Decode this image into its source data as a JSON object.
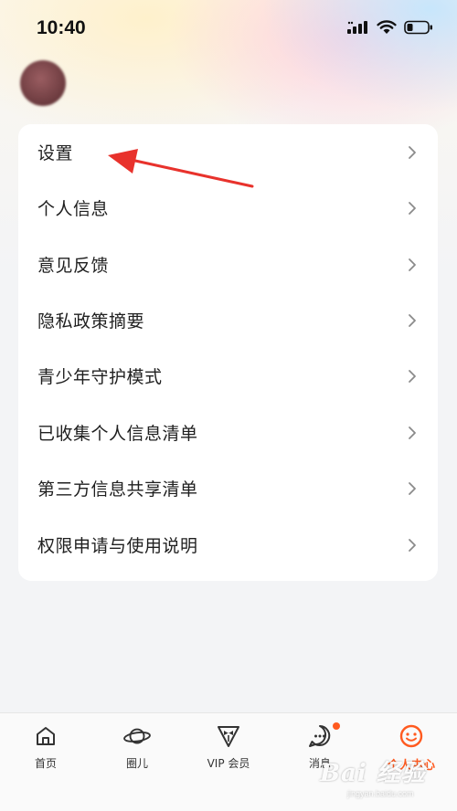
{
  "status_bar": {
    "time": "10:40",
    "icons": [
      "cellular-signal-icon",
      "wifi-icon",
      "battery-icon"
    ]
  },
  "profile": {
    "avatar": "avatar-blurred"
  },
  "menu": {
    "items": [
      {
        "label": "设置",
        "icon": "chevron-right-icon"
      },
      {
        "label": "个人信息",
        "icon": "chevron-right-icon"
      },
      {
        "label": "意见反馈",
        "icon": "chevron-right-icon"
      },
      {
        "label": "隐私政策摘要",
        "icon": "chevron-right-icon"
      },
      {
        "label": "青少年守护模式",
        "icon": "chevron-right-icon"
      },
      {
        "label": "已收集个人信息清单",
        "icon": "chevron-right-icon"
      },
      {
        "label": "第三方信息共享清单",
        "icon": "chevron-right-icon"
      },
      {
        "label": "权限申请与使用说明",
        "icon": "chevron-right-icon"
      }
    ]
  },
  "annotation": {
    "arrow_color": "#e8322c",
    "points_to": "设置"
  },
  "tab_bar": {
    "active_color": "#ff5a1f",
    "tabs": [
      {
        "label": "首页",
        "icon": "home-icon",
        "active": false
      },
      {
        "label": "圈儿",
        "icon": "planet-icon",
        "active": false
      },
      {
        "label": "VIP 会员",
        "icon": "tuxedo-vip-icon",
        "active": false
      },
      {
        "label": "消息",
        "icon": "chat-bubble-icon",
        "active": false,
        "badge": true
      },
      {
        "label": "个人中心",
        "icon": "smiley-icon",
        "active": true
      }
    ]
  },
  "watermark": {
    "text": "Bai 经验",
    "sub": "jingyan.baidu.com"
  }
}
